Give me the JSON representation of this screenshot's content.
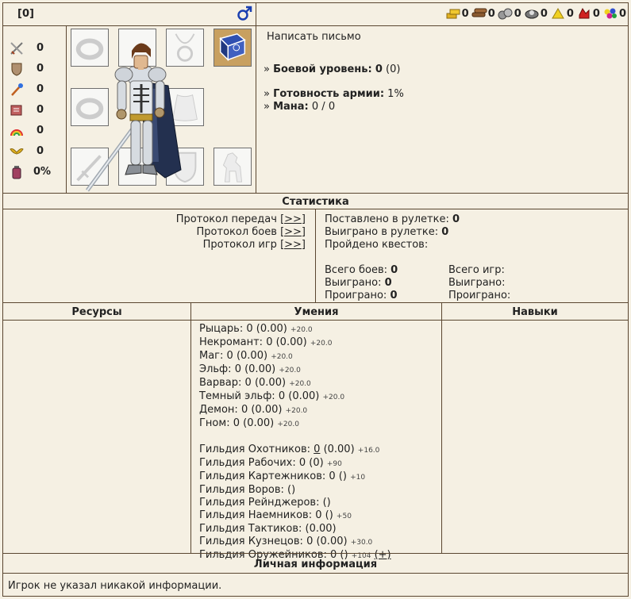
{
  "header": {
    "level_tag": "[0]",
    "gender_icon": "male-icon",
    "resources": [
      {
        "icon": "gold-icon",
        "value": "0"
      },
      {
        "icon": "wood-icon",
        "value": "0"
      },
      {
        "icon": "ore-icon",
        "value": "0"
      },
      {
        "icon": "mercury-icon",
        "value": "0"
      },
      {
        "icon": "sulfur-icon",
        "value": "0"
      },
      {
        "icon": "crystal-icon",
        "value": "0"
      },
      {
        "icon": "gems-icon",
        "value": "0"
      }
    ]
  },
  "stats": [
    {
      "icon": "sword-icon",
      "value": "0"
    },
    {
      "icon": "shield-icon",
      "value": "0"
    },
    {
      "icon": "wand-icon",
      "value": "0"
    },
    {
      "icon": "spellbook-icon",
      "value": "0"
    },
    {
      "icon": "rainbow-icon",
      "value": "0"
    },
    {
      "icon": "wings-icon",
      "value": "0"
    },
    {
      "icon": "bottle-icon",
      "value": "0%"
    }
  ],
  "info": {
    "write_letter": "Написать письмо",
    "combat_level_label": "Боевой уровень:",
    "combat_level_value": "0",
    "combat_level_extra": "(0)",
    "army_ready_label": "Готовность армии:",
    "army_ready_value": "1%",
    "mana_label": "Мана:",
    "mana_value": "0 / 0"
  },
  "statistics": {
    "title": "Статистика",
    "links": [
      {
        "label": "Протокол передач",
        "action": "[>>]"
      },
      {
        "label": "Протокол боев",
        "action": "[>>]"
      },
      {
        "label": "Протокол игр",
        "action": "[>>]"
      }
    ],
    "roulette_bet_label": "Поставлено в рулетке:",
    "roulette_bet_value": "0",
    "roulette_won_label": "Выиграно в рулетке:",
    "roulette_won_value": "0",
    "quests_label": "Пройдено квестов:",
    "battles_total_label": "Всего боев:",
    "battles_total_value": "0",
    "battles_won_label": "Выиграно:",
    "battles_won_value": "0",
    "battles_lost_label": "Проиграно:",
    "battles_lost_value": "0",
    "games_total_label": "Всего игр:",
    "games_won_label": "Выиграно:",
    "games_lost_label": "Проиграно:"
  },
  "columns": {
    "resources": "Ресурсы",
    "skills": "Умения",
    "talents": "Навыки"
  },
  "factions": [
    {
      "name": "Рыцарь:",
      "value": "0 (0.00)",
      "bonus": "+20.0"
    },
    {
      "name": "Некромант:",
      "value": "0 (0.00)",
      "bonus": "+20.0"
    },
    {
      "name": "Маг:",
      "value": "0 (0.00)",
      "bonus": "+20.0"
    },
    {
      "name": "Эльф:",
      "value": "0 (0.00)",
      "bonus": "+20.0"
    },
    {
      "name": "Варвар:",
      "value": "0 (0.00)",
      "bonus": "+20.0"
    },
    {
      "name": "Темный эльф:",
      "value": "0 (0.00)",
      "bonus": "+20.0"
    },
    {
      "name": "Демон:",
      "value": "0 (0.00)",
      "bonus": "+20.0"
    },
    {
      "name": "Гном:",
      "value": "0 (0.00)",
      "bonus": "+20.0"
    }
  ],
  "guilds": [
    {
      "name": "Гильдия Охотников:",
      "link": "0",
      "value": "(0.00)",
      "bonus": "+16.0"
    },
    {
      "name": "Гильдия Рабочих:",
      "value": "0 (0)",
      "bonus": "+90"
    },
    {
      "name": "Гильдия Картежников:",
      "value": "0 ()",
      "bonus": "+10"
    },
    {
      "name": "Гильдия Воров:",
      "value": "()",
      "bonus": ""
    },
    {
      "name": "Гильдия Рейнджеров:",
      "value": "()",
      "bonus": ""
    },
    {
      "name": "Гильдия Наемников:",
      "value": "0 ()",
      "bonus": "+50"
    },
    {
      "name": "Гильдия Тактиков:",
      "value": "(0.00)",
      "bonus": ""
    },
    {
      "name": "Гильдия Кузнецов:",
      "value": "0 (0.00)",
      "bonus": "+30.0"
    },
    {
      "name": "Гильдия Оружейников:",
      "value": "0 ()",
      "bonus": "+104",
      "plus": "(+)"
    }
  ],
  "personal": {
    "title": "Личная информация",
    "text": "Игрок не указал никакой информации."
  }
}
